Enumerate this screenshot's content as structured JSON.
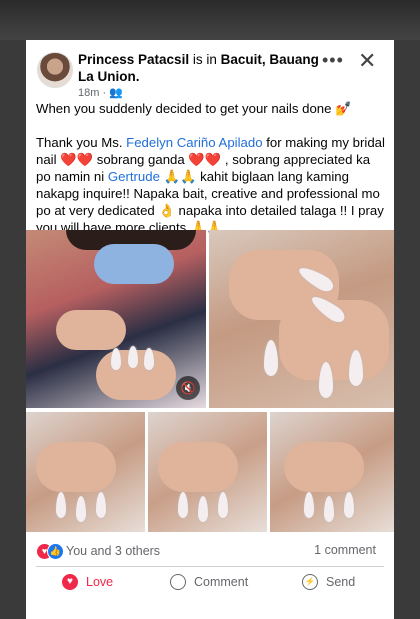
{
  "post": {
    "author": "Princess Patacsil",
    "verb": "is in",
    "location": "Bacuit, Bauang La Union.",
    "time": "18m",
    "separator": "·",
    "audience_icon": "friends-icon",
    "more_icon": "more-dots-icon",
    "close_icon": "close-icon",
    "line1": "When you suddenly decided to get your nails done 💅",
    "body_start": "Thank you Ms.",
    "tag1": "Fedelyn Cariño Apilado",
    "body_mid1": "for making my bridal nail",
    "hearts1": "❤️❤️",
    "body_mid2": "sobrang ganda",
    "hearts2": "❤️❤️",
    "body_mid3": ", sobrang appreciated ka po namin ni",
    "tag2": "Gertrude",
    "pray1": "🙏🙏",
    "body_mid4": "kahit biglaan lang kaming nakapg inquire!! Napaka bait, creative and professional mo po at very dedicated",
    "ok_hand": "👌",
    "body_mid5": "napaka into detailed talaga !! I pray you will have more clients",
    "pray2": "🙏🙏"
  },
  "media": {
    "mute_icon": "speaker-mute-icon",
    "mute_glyph": "🔇"
  },
  "reactions": {
    "love_glyph": "♥",
    "like_glyph": "👍",
    "summary": "You and 3 others",
    "comments": "1 comment"
  },
  "actions": {
    "love": "Love",
    "comment": "Comment",
    "send": "Send"
  },
  "colors": {
    "link": "#216fdb",
    "love": "#f0284a",
    "like": "#1877f2",
    "muted": "#65676b"
  }
}
